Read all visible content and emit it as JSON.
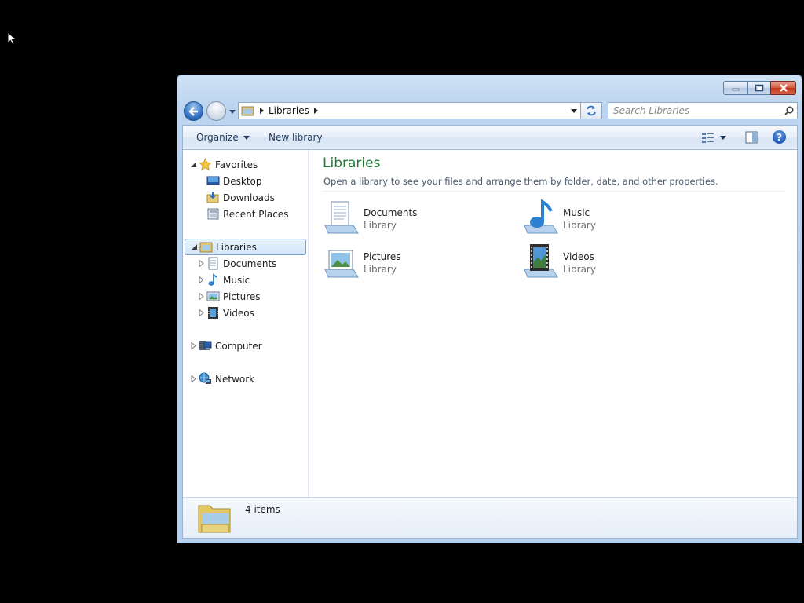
{
  "window": {
    "caption_buttons": [
      "minimize-icon",
      "maximize-icon",
      "close-icon"
    ]
  },
  "address": {
    "crumb": "Libraries",
    "search_placeholder": "Search Libraries"
  },
  "toolbar": {
    "organize": "Organize",
    "new_library": "New library",
    "help_glyph": "?"
  },
  "navpane": {
    "favorites": {
      "label": "Favorites",
      "items": [
        "Desktop",
        "Downloads",
        "Recent Places"
      ]
    },
    "libraries": {
      "label": "Libraries",
      "items": [
        "Documents",
        "Music",
        "Pictures",
        "Videos"
      ]
    },
    "computer": "Computer",
    "network": "Network"
  },
  "main": {
    "title": "Libraries",
    "description": "Open a library to see your files and arrange them by folder, date, and other properties.",
    "libraries": [
      {
        "name": "Documents",
        "type": "Library",
        "icon": "documents-library-icon"
      },
      {
        "name": "Music",
        "type": "Library",
        "icon": "music-library-icon"
      },
      {
        "name": "Pictures",
        "type": "Library",
        "icon": "pictures-library-icon"
      },
      {
        "name": "Videos",
        "type": "Library",
        "icon": "videos-library-icon"
      }
    ]
  },
  "details": {
    "count": "4 items"
  },
  "colors": {
    "title_green": "#1e7a34",
    "selection_blue": "#d3e6fb",
    "close_red": "#c2391b"
  }
}
